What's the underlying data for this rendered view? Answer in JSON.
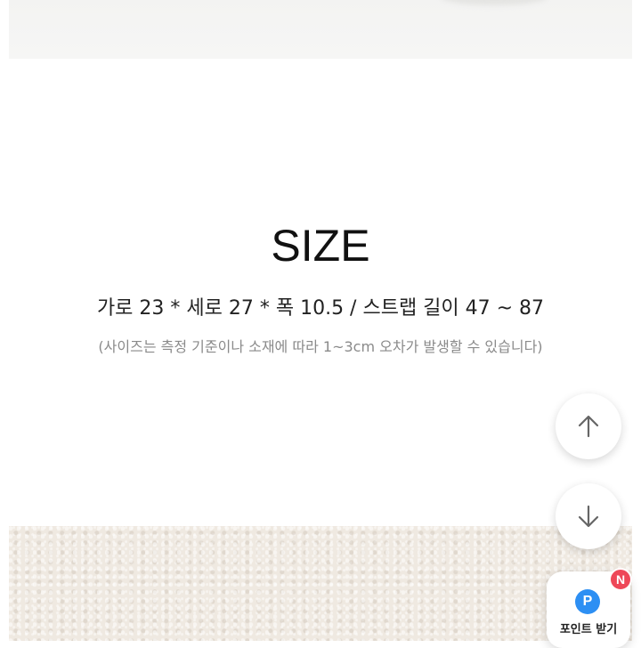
{
  "size_section": {
    "title": "SIZE",
    "dimensions": "가로 23 * 세로 27 * 폭 10.5 / 스트랩 길이 47 ~ 87",
    "note": "(사이즈는 측정 기준이나 소재에 따라 1~3cm 오차가 발생할 수 있습니다)"
  },
  "floating": {
    "scroll_up_icon": "arrow-up-icon",
    "scroll_down_icon": "arrow-down-icon",
    "point_icon_letter": "P",
    "point_label": "포인트 받기",
    "new_badge": "N"
  },
  "colors": {
    "point_blue": "#2d8ff3",
    "badge_red": "#ee4758",
    "beige": "#efe9e1"
  }
}
